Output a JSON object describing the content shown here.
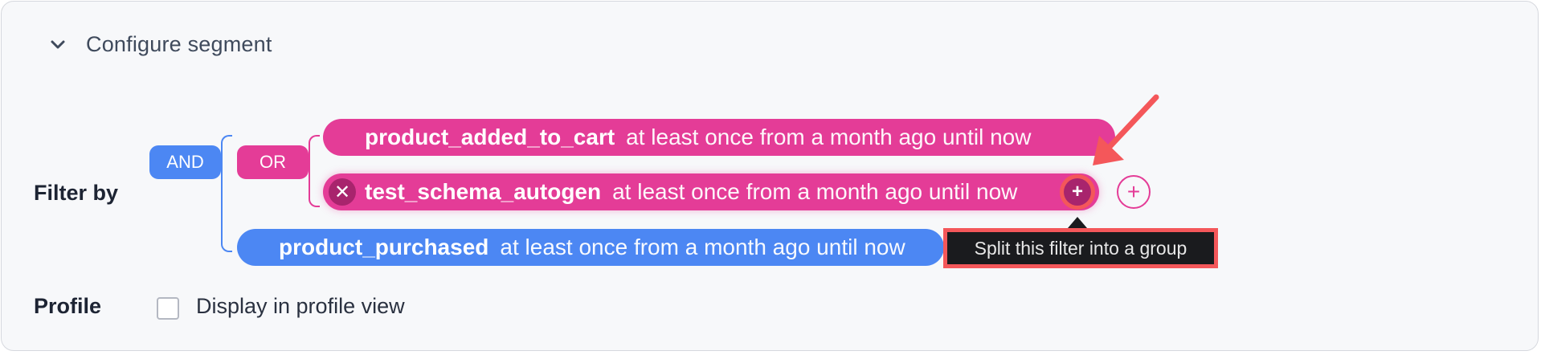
{
  "header": {
    "title": "Configure segment"
  },
  "filter_by": {
    "label": "Filter by",
    "and_operator": "AND",
    "or_operator": "OR",
    "filters": [
      {
        "event": "product_added_to_cart",
        "condition": "at least once from a month ago until now"
      },
      {
        "event": "test_schema_autogen",
        "condition": "at least once from a month ago until now"
      },
      {
        "event": "product_purchased",
        "condition": "at least once from a month ago until now"
      }
    ],
    "remove_symbol": "✕",
    "split_symbol": "+",
    "add_symbol": "+",
    "tooltip": "Split this filter into a group"
  },
  "profile": {
    "label": "Profile",
    "checkbox_label": "Display in profile view",
    "checked": false
  },
  "colors": {
    "or_group": "#e43c97",
    "and_group": "#4c87f3",
    "highlight": "#f4575a"
  }
}
